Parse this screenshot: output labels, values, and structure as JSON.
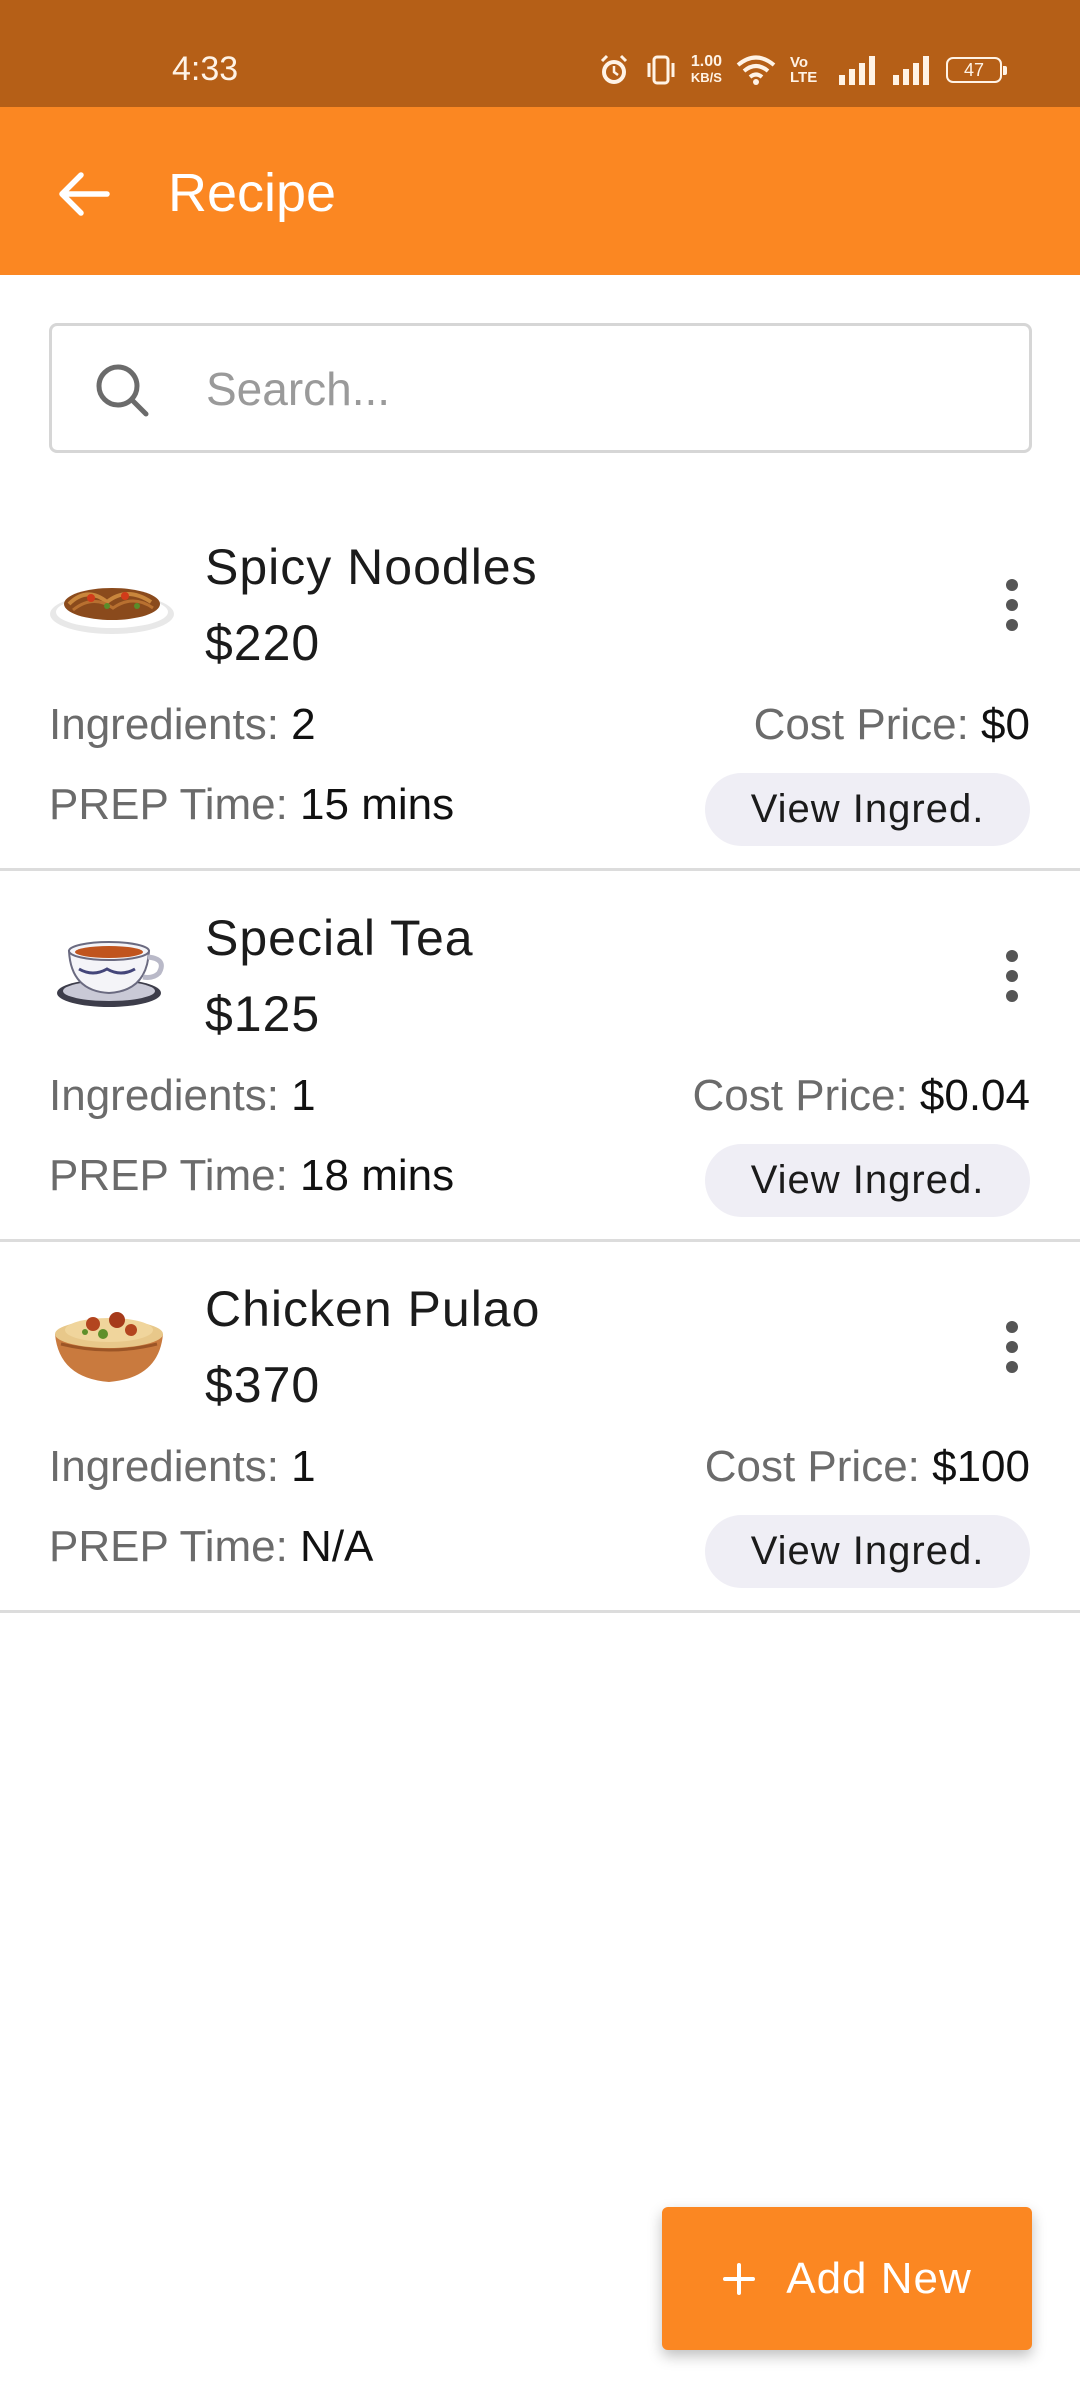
{
  "status_bar": {
    "time": "4:33",
    "net_speed_value": "1.00",
    "net_speed_unit": "KB/S",
    "volte": "Vo LTE",
    "battery": "47"
  },
  "app_bar": {
    "title": "Recipe"
  },
  "search": {
    "placeholder": "Search..."
  },
  "labels": {
    "ingredients": "Ingredients: ",
    "cost_price": "Cost Price: ",
    "prep_time": "PREP Time: ",
    "view_button": "View Ingred."
  },
  "recipes": [
    {
      "name": "Spicy Noodles",
      "price": "$220",
      "ingredients": "2",
      "cost_price": "$0",
      "prep_time": "15 mins",
      "image": "noodles-image"
    },
    {
      "name": "Special Tea",
      "price": "$125",
      "ingredients": "1",
      "cost_price": "$0.04",
      "prep_time": "18 mins",
      "image": "tea-cup-image"
    },
    {
      "name": "Chicken Pulao",
      "price": "$370",
      "ingredients": "1",
      "cost_price": "$100",
      "prep_time": "N/A",
      "image": "pulao-bowl-image"
    }
  ],
  "fab": {
    "label": "Add New"
  },
  "colors": {
    "accent": "#fb8722",
    "status_bar": "#b55f17",
    "chip_bg": "#efeef5"
  }
}
